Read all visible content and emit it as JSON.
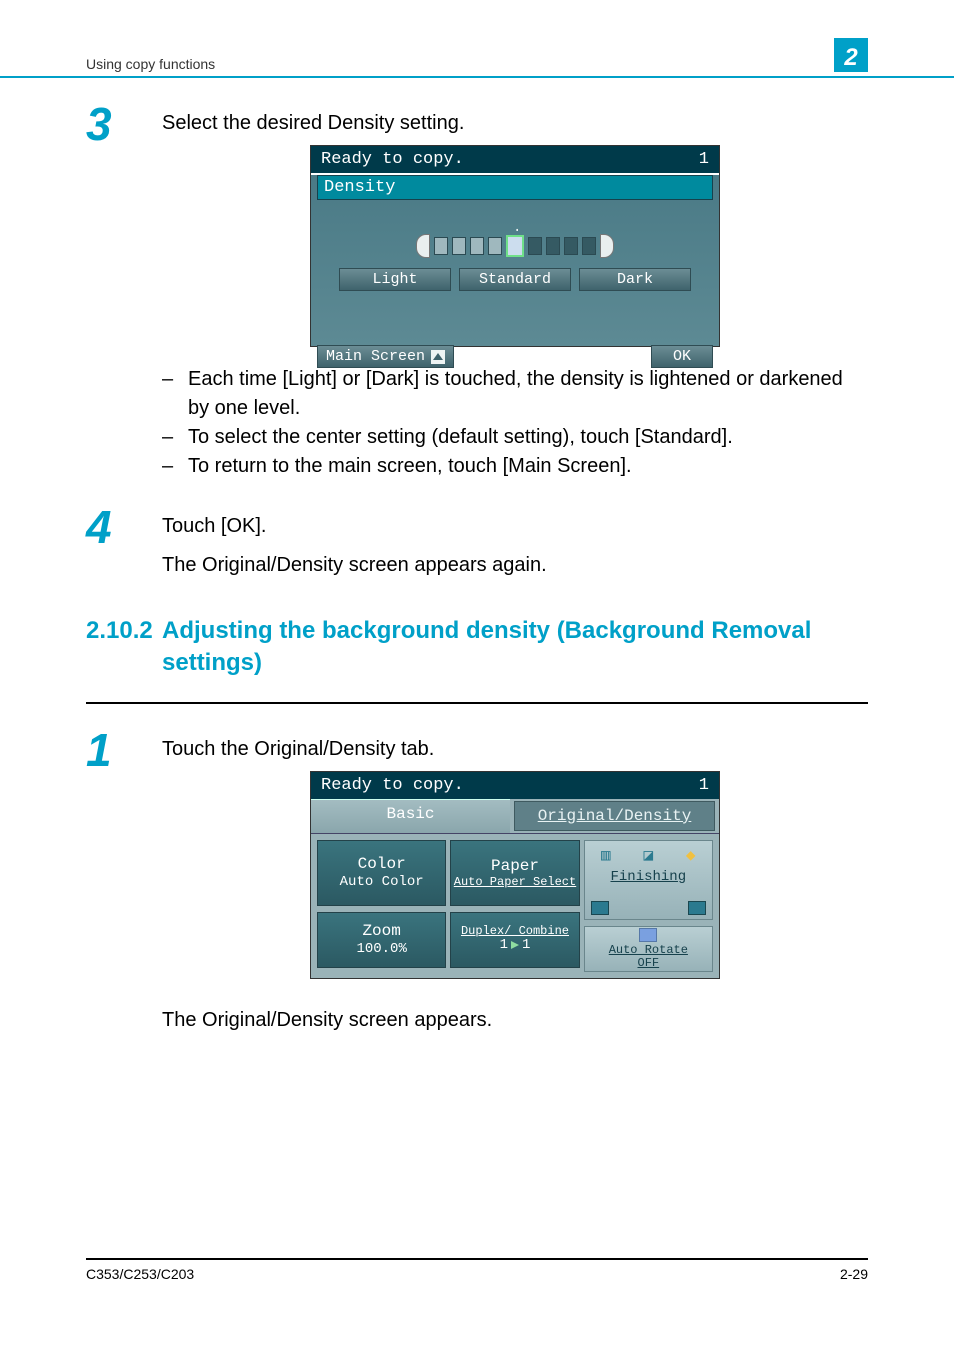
{
  "header": {
    "title": "Using copy functions",
    "chapter": "2"
  },
  "footer": {
    "model": "C353/C253/C203",
    "page": "2-29"
  },
  "step3": {
    "num": "3",
    "text": "Select the desired Density setting."
  },
  "densityScreen": {
    "status": "Ready to copy.",
    "count": "1",
    "title": "Density",
    "light": "Light",
    "standard": "Standard",
    "dark": "Dark",
    "mainScreen": "Main Screen",
    "ok": "OK"
  },
  "bullets3": [
    "Each time [Light] or [Dark] is touched, the density is lightened or darkened by one level.",
    "To select the center setting (default setting), touch [Standard].",
    "To return to the main screen, touch [Main Screen]."
  ],
  "step4": {
    "num": "4",
    "text": "Touch [OK].",
    "sub": "The Original/Density screen appears again."
  },
  "section": {
    "num": "2.10.2",
    "title": "Adjusting the background density (Background Removal settings)"
  },
  "step1": {
    "num": "1",
    "text": "Touch the Original/Density tab."
  },
  "basicScreen": {
    "status": "Ready to copy.",
    "count": "1",
    "tabBasic": "Basic",
    "tabOD": "Original/Density",
    "color": "Color",
    "colorVal": "Auto Color",
    "paper": "Paper",
    "paperVal": "Auto Paper\nSelect",
    "zoom": "Zoom",
    "zoomVal": "100.0%",
    "duplex": "Duplex/\nCombine",
    "duplexVal1": "1",
    "duplexVal2": "1",
    "finishing": "Finishing",
    "autoRotate": "Auto Rotate\nOFF"
  },
  "after1": "The Original/Density screen appears."
}
